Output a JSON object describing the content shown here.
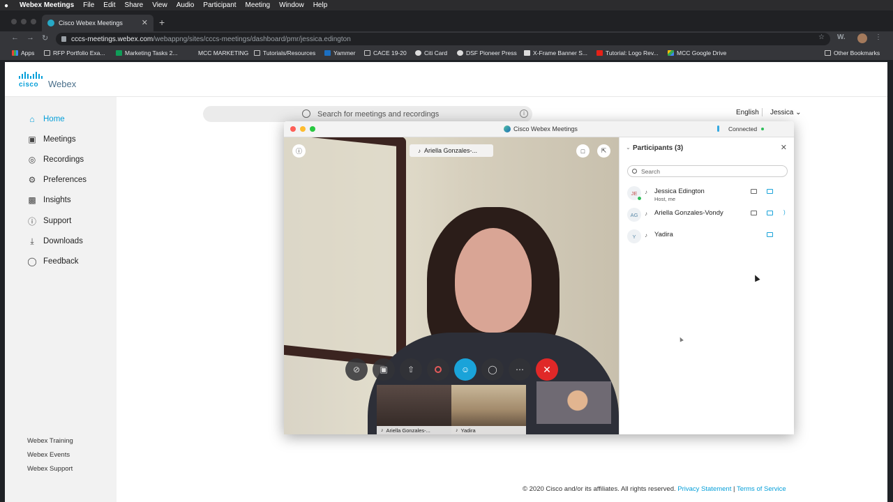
{
  "menubar": {
    "app": "Webex Meetings",
    "items": [
      "File",
      "Edit",
      "Share",
      "View",
      "Audio",
      "Participant",
      "Meeting",
      "Window",
      "Help"
    ]
  },
  "browser": {
    "tab_title": "Cisco Webex Meetings",
    "url_host": "cccs-meetings.webex.com",
    "url_path": "/webappng/sites/cccs-meetings/dashboard/pmr/jessica.edington",
    "bookmarks": [
      {
        "label": "Apps",
        "icon": "apps-grid-icon"
      },
      {
        "label": "RFP Portfolio Exa...",
        "icon": "folder-icon"
      },
      {
        "label": "Marketing Tasks 2...",
        "icon": "sheets-icon"
      },
      {
        "label": "MCC MARKETING",
        "icon": "none"
      },
      {
        "label": "Tutorials/Resources",
        "icon": "folder-icon"
      },
      {
        "label": "Yammer",
        "icon": "yammer-icon"
      },
      {
        "label": "CACE 19-20",
        "icon": "folder-icon"
      },
      {
        "label": "Citi Card",
        "icon": "globe-icon"
      },
      {
        "label": "DSF Pioneer Press",
        "icon": "globe-icon"
      },
      {
        "label": "X-Frame Banner S...",
        "icon": "x-icon"
      },
      {
        "label": "Tutorial: Logo Rev...",
        "icon": "youtube-icon"
      },
      {
        "label": "MCC Google Drive",
        "icon": "drive-icon"
      }
    ],
    "other_bookmarks": "Other Bookmarks"
  },
  "site": {
    "logo_cisco": "cisco",
    "logo_webex": "Webex",
    "search_placeholder": "Search for meetings and recordings",
    "language": "English",
    "user": "Jessica",
    "nav": [
      {
        "label": "Home",
        "icon": "home-icon",
        "active": true
      },
      {
        "label": "Meetings",
        "icon": "calendar-icon"
      },
      {
        "label": "Recordings",
        "icon": "recording-icon"
      },
      {
        "label": "Preferences",
        "icon": "gear-icon"
      },
      {
        "label": "Insights",
        "icon": "insights-icon"
      },
      {
        "label": "Support",
        "icon": "help-icon"
      },
      {
        "label": "Downloads",
        "icon": "download-icon"
      },
      {
        "label": "Feedback",
        "icon": "feedback-icon"
      }
    ],
    "footer_links": [
      "Webex Training",
      "Webex Events",
      "Webex Support"
    ],
    "copyright": "© 2020 Cisco and/or its affiliates. All rights reserved.",
    "privacy": "Privacy Statement",
    "separator": "|",
    "terms": "Terms of Service",
    "accent": "#049fd9"
  },
  "meeting": {
    "window_title": "Cisco Webex Meetings",
    "status": "Connected",
    "active_speaker": "Ariella Gonzales-...",
    "thumbnails": [
      {
        "label": "Ariella Gonzales-..."
      },
      {
        "label": "Yadira"
      }
    ],
    "participants_title": "Participants (3)",
    "participants_search": "Search",
    "participants": [
      {
        "initials": "JE",
        "name": "Jessica Edington",
        "role": "Host, me",
        "host": true
      },
      {
        "initials": "AG",
        "name": "Ariella Gonzales-Vondy",
        "role": ""
      },
      {
        "initials": "Y",
        "name": "Yadira",
        "role": ""
      }
    ]
  }
}
